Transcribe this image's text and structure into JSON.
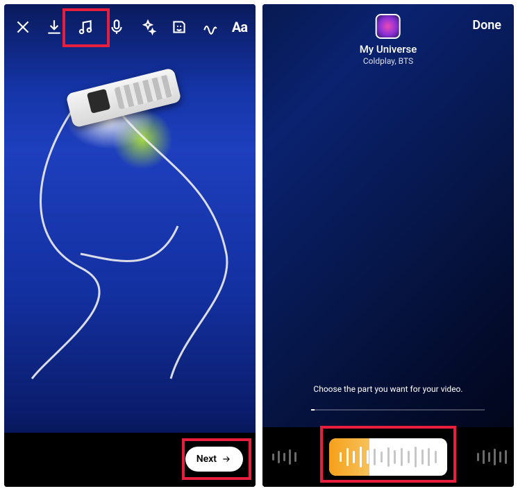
{
  "left": {
    "toolbar": {
      "close": "close-icon",
      "download": "download-icon",
      "music": "music-icon",
      "mic": "microphone-icon",
      "sparkles": "sparkles-icon",
      "sticker": "sticker-icon",
      "scribble": "scribble-icon",
      "text_tool_label": "Aa"
    },
    "next_label": "Next"
  },
  "right": {
    "done_label": "Done",
    "song": {
      "title": "My Universe",
      "artist": "Coldplay,  BTS"
    },
    "instruction": "Choose the part you want for your video."
  },
  "highlight_color": "#e91e3c"
}
